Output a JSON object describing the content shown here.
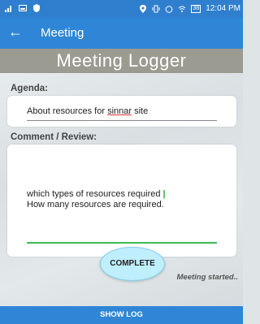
{
  "status_bar": {
    "time": "12:04 PM",
    "battery": "38"
  },
  "app_bar": {
    "title": "Meeting"
  },
  "header": {
    "title": "Meeting Logger"
  },
  "agenda": {
    "label": "Agenda:",
    "value_prefix": "About resources for ",
    "value_misspelled": "sinnar",
    "value_suffix": " site"
  },
  "comment": {
    "label": "Comment / Review:",
    "line1": "which types of  resources required",
    "line2": "How many resources are required."
  },
  "actions": {
    "complete_label": "COMPLETE"
  },
  "status": {
    "text": "Meeting started.."
  },
  "bottom_bar": {
    "show_log_label": "SHOW LOG"
  }
}
